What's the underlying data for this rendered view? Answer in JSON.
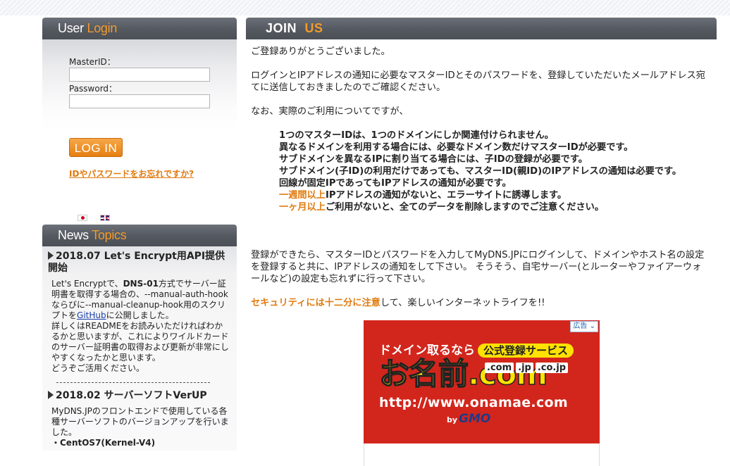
{
  "login": {
    "title_part1": "User",
    "title_part2": "Login",
    "master_id_label": "MasterID：",
    "password_label": "Password：",
    "button_label": "LOG IN",
    "forgot_link": "IDやパスワードをお忘れですか?"
  },
  "news": {
    "title_part1": "News",
    "title_part2": "Topics",
    "items": [
      {
        "title": "2018.07 Let's Encrypt用API提供開始",
        "body_1": "Let's Encryptで、",
        "body_bold": "DNS-01",
        "body_2": "方式でサーバー証明書を取得する場合の、--manual-auth-hookならびに--manual-cleanup-hook用のスクリプトを",
        "link": "GitHub",
        "body_3": "に公開しました。",
        "body_4": "詳しくはREADMEをお読みいただければわかるかと思いますが、これによりワイルドカードのサーバー証明書の取得および更新が非常にしやすくなったかと思います。",
        "body_5": "どうぞご活用ください。"
      },
      {
        "title": "2018.02 サーバーソフトVerUP",
        "body": "MyDNS.JPのフロントエンドで使用している各種サーバーソフトのバージョンアップを行いました。",
        "bullet": "・CentOS7(Kernel-V4)"
      }
    ]
  },
  "join": {
    "title_part1": "JOIN",
    "title_part2": "US",
    "thanks": "ご登録ありがとうございました。",
    "sent_msg": "ログインとIPアドレスの通知に必要なマスターIDとそのパスワードを、登録していただいたメールアドレス宛てに送信しておきましたのでご確認ください。",
    "usage_intro": "なお、実際のご利用についてですが、",
    "notes": [
      "1つのマスターIDは、1つのドメインにしか関連付けられません。",
      "異なるドメインを利用する場合には、必要なドメイン数だけマスターIDが必要です。",
      "サブドメインを異なるIPに割り当てる場合には、子IDの登録が必要です。",
      "サブドメイン(子ID)の利用だけであっても、マスターID(親ID)のIPアドレスの通知は必要です。",
      "回線が固定IPであってもIPアドレスの通知が必要です。"
    ],
    "warn1_accent": "一週間以上",
    "warn1_rest": "IPアドレスの通知がないと、エラーサイトに誘導します。",
    "warn2_accent": "一ヶ月以上",
    "warn2_rest": "ご利用がないと、全てのデータを削除しますのでご注意ください。",
    "after_msg": "登録ができたら、マスターIDとパスワードを入力してMyDNS.JPにログインして、ドメインやホスト名の設定を登録すると共に、IPアドレスの通知をして下さい。 そうそう、自宅サーバー(とルーターやファイアーウォールなど)の設定も忘れずに行って下さい。",
    "security_accent": "セキュリティには十二分に注意",
    "security_rest": "して、楽しいインターネットライフを!!"
  },
  "ad": {
    "tag": "広告",
    "headline": "ドメイン取るなら",
    "pill": "公式登録サービス",
    "brand": "お名前.com",
    "domains": [
      ".com",
      ".jp",
      ".co.jp"
    ],
    "url": "http://www.onamae.com",
    "by": "by",
    "gmo": "GMO"
  },
  "colors": {
    "accent": "#e07b10",
    "header_bg": "#54585f",
    "ad_bg": "#d2261c"
  }
}
